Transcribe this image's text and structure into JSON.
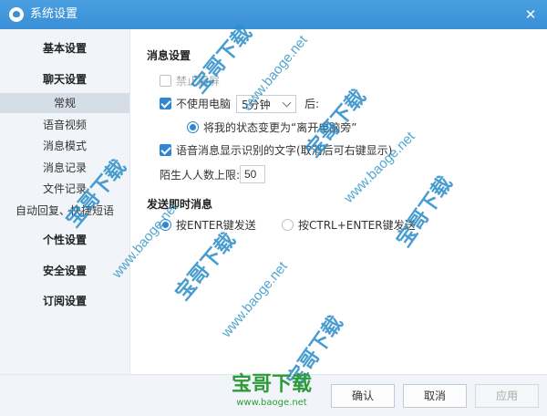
{
  "window": {
    "title": "系统设置",
    "close_glyph": "✕",
    "icon": "app-logo-icon"
  },
  "sidebar": {
    "sections": {
      "basic": "基本设置",
      "chat": "聊天设置",
      "personal": "个性设置",
      "security": "安全设置",
      "subscription": "订阅设置"
    },
    "items": [
      "常规",
      "语音视频",
      "消息模式",
      "消息记录",
      "文件记录",
      "自动回复、快捷短语"
    ],
    "active_item": "常规"
  },
  "content": {
    "message_settings": {
      "title": "消息设置",
      "no_vibrate": {
        "label": "禁止震屏",
        "checked": false,
        "disabled": true
      },
      "idle": {
        "label": "不使用电脑",
        "checked": true,
        "duration": "5分钟",
        "after_text": "后:",
        "status_option": {
          "label": "将我的状态变更为“离开电脑旁”",
          "selected": true
        }
      },
      "voice_text": {
        "label": "语音消息显示识别的文字(取消后可右键显示)",
        "checked": true
      },
      "stranger_limit": {
        "label": "陌生人人数上限:",
        "value": "50"
      }
    },
    "send_settings": {
      "title": "发送即时消息",
      "options": [
        {
          "label": "按ENTER键发送",
          "selected": true
        },
        {
          "label": "按CTRL+ENTER键发送",
          "selected": false
        }
      ]
    }
  },
  "footer": {
    "confirm": "确认",
    "cancel": "取消",
    "apply": "应用"
  },
  "watermarks": {
    "cn": "宝哥下载",
    "url": "www.baoge.net",
    "logo_cn": "宝哥下载",
    "logo_url": "www.baoge.net"
  },
  "colors": {
    "title_bar": "#3a8fd6",
    "accent": "#2f86d3",
    "sidebar_bg": "#f1f4f8",
    "watermark": "#2f9a3a"
  }
}
